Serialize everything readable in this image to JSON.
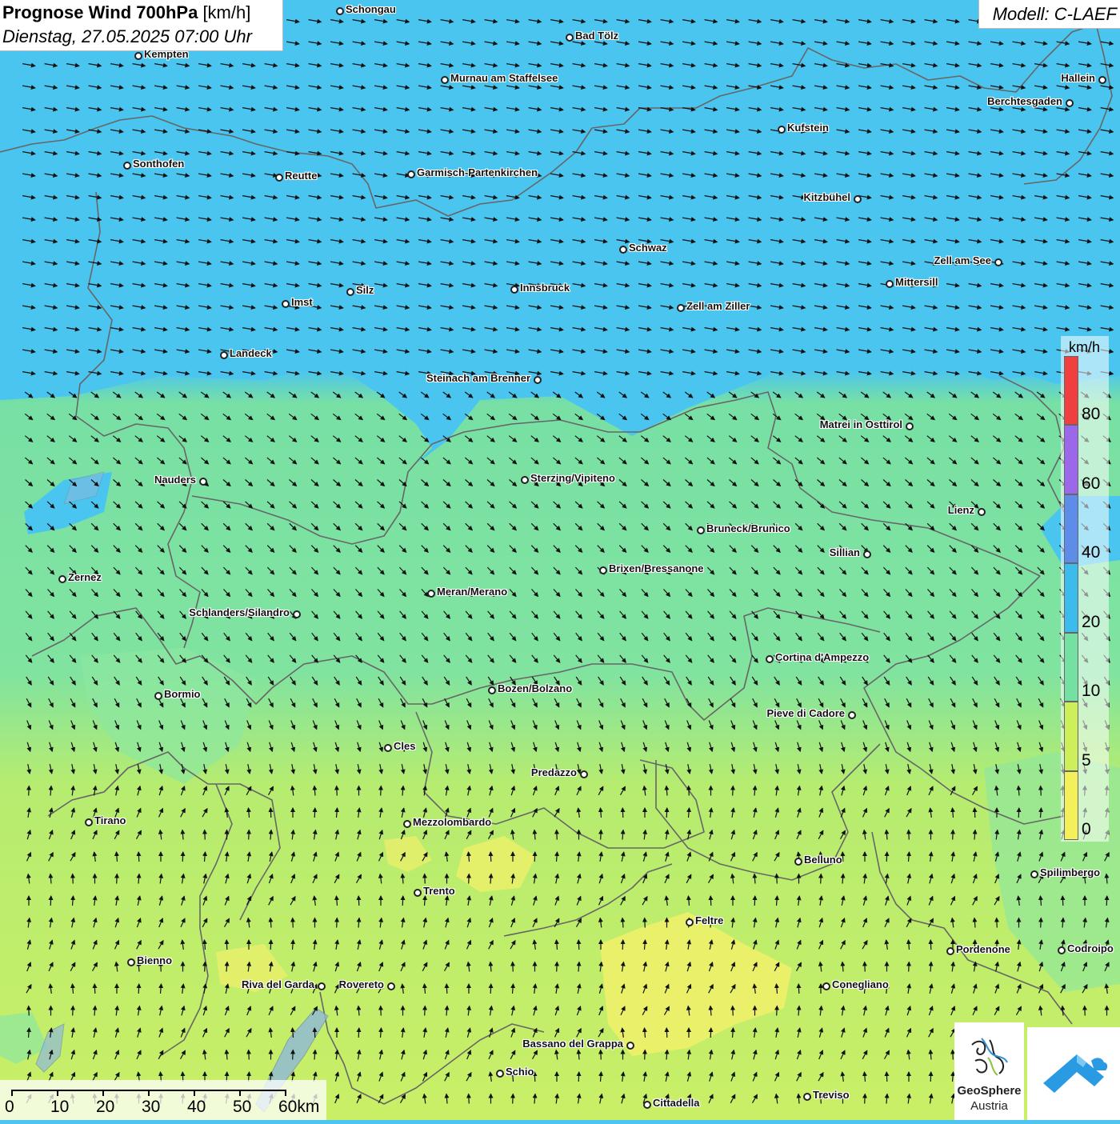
{
  "header": {
    "title_bold": "Prognose Wind 700hPa",
    "title_unit": "[km/h]",
    "datetime": "Dienstag, 27.05.2025 07:00 Uhr"
  },
  "model": "Modell: C-LAEF",
  "legend": {
    "unit": "km/h",
    "segments": [
      {
        "color": "#f4f05a",
        "label": "0"
      },
      {
        "color": "#cdef5a",
        "label": "5"
      },
      {
        "color": "#74e1a3",
        "label": "10"
      },
      {
        "color": "#3bbcec",
        "label": "20"
      },
      {
        "color": "#5e8de9",
        "label": "40"
      },
      {
        "color": "#9b68ea",
        "label": "60"
      },
      {
        "color": "#f03f3f",
        "label": "80"
      }
    ]
  },
  "scale": {
    "labels": [
      "0",
      "10",
      "20",
      "30",
      "40",
      "50",
      "60km"
    ]
  },
  "cities": [
    {
      "name": "Schongau"
    },
    {
      "name": "Bad Tölz"
    },
    {
      "name": "Kempten"
    },
    {
      "name": "Murnau am Staffelsee"
    },
    {
      "name": "Hallein"
    },
    {
      "name": "Berchtesgaden"
    },
    {
      "name": "Kufstein"
    },
    {
      "name": "Sonthofen"
    },
    {
      "name": "Reutte"
    },
    {
      "name": "Garmisch-Partenkirchen"
    },
    {
      "name": "Kitzbühel"
    },
    {
      "name": "Schwaz"
    },
    {
      "name": "Zell am See"
    },
    {
      "name": "Mittersill"
    },
    {
      "name": "Silz"
    },
    {
      "name": "Innsbruck"
    },
    {
      "name": "Imst"
    },
    {
      "name": "Zell am Ziller"
    },
    {
      "name": "Landeck"
    },
    {
      "name": "Steinach am Brenner"
    },
    {
      "name": "Matrei in Osttirol"
    },
    {
      "name": "Nauders"
    },
    {
      "name": "Sterzing/Vipiteno"
    },
    {
      "name": "Lienz"
    },
    {
      "name": "Bruneck/Brunico"
    },
    {
      "name": "Sillian"
    },
    {
      "name": "Zernez"
    },
    {
      "name": "Brixen/Bressanone"
    },
    {
      "name": "Meran/Merano"
    },
    {
      "name": "Schlanders/Silandro"
    },
    {
      "name": "Cortina d'Ampezzo"
    },
    {
      "name": "Bozen/Bolzano"
    },
    {
      "name": "Bormio"
    },
    {
      "name": "Pieve di Cadore"
    },
    {
      "name": "Cles"
    },
    {
      "name": "Predazzo"
    },
    {
      "name": "Tirano"
    },
    {
      "name": "Mezzolombardo"
    },
    {
      "name": "Belluno"
    },
    {
      "name": "Spilimbergo"
    },
    {
      "name": "Trento"
    },
    {
      "name": "Feltre"
    },
    {
      "name": "Pordenone"
    },
    {
      "name": "Codroipo"
    },
    {
      "name": "Bienno"
    },
    {
      "name": "Riva del Garda"
    },
    {
      "name": "Rovereto"
    },
    {
      "name": "Conegliano"
    },
    {
      "name": "Bassano del Grappa"
    },
    {
      "name": "Schio"
    },
    {
      "name": "Treviso"
    },
    {
      "name": "Cittadella"
    }
  ],
  "logos": {
    "geosphere_name": "GeoSphere",
    "geosphere_country": "Austria"
  }
}
